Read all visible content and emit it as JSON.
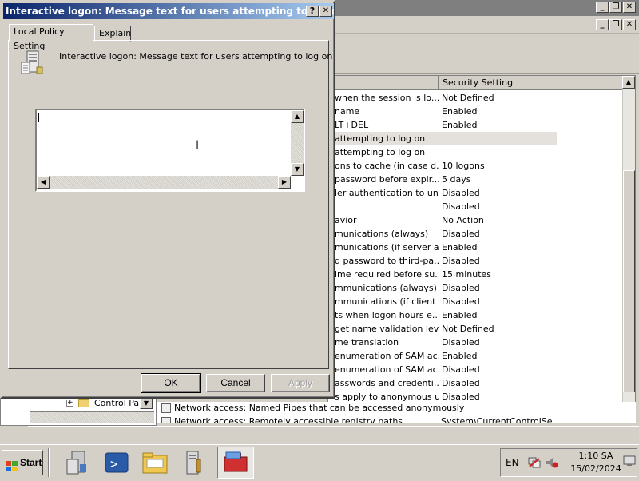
{
  "dialog": {
    "title": "Interactive logon: Message text for users attempting to log on Pr...",
    "tabs": [
      "Local Policy Setting",
      "Explain"
    ],
    "policy_name": "Interactive logon: Message text for users attempting to log on",
    "message_text": "",
    "buttons": {
      "ok": "OK",
      "cancel": "Cancel",
      "apply": "Apply"
    },
    "title_controls": {
      "help": "?",
      "close": "✕"
    }
  },
  "mmc": {
    "header": {
      "policy": "",
      "security_setting": "Security Setting"
    },
    "rows": [
      {
        "policy": "when the session is lo...",
        "setting": "Not Defined"
      },
      {
        "policy": "name",
        "setting": "Enabled"
      },
      {
        "policy": "LT+DEL",
        "setting": "Enabled"
      },
      {
        "policy": "attempting to log on",
        "setting": ""
      },
      {
        "policy": "attempting to log on",
        "setting": ""
      },
      {
        "policy": "ons to cache (in case d...",
        "setting": "10 logons"
      },
      {
        "policy": "password before expir...",
        "setting": "5 days"
      },
      {
        "policy": "ler authentication to un...",
        "setting": "Disabled"
      },
      {
        "policy": "",
        "setting": "Disabled"
      },
      {
        "policy": "avior",
        "setting": "No Action"
      },
      {
        "policy": "munications (always)",
        "setting": "Disabled"
      },
      {
        "policy": "munications (if server a...",
        "setting": "Enabled"
      },
      {
        "policy": "d password to third-pa...",
        "setting": "Disabled"
      },
      {
        "policy": "ime required before su...",
        "setting": "15 minutes"
      },
      {
        "policy": "mmunications (always)",
        "setting": "Disabled"
      },
      {
        "policy": "mmunications (if client a...",
        "setting": "Disabled"
      },
      {
        "policy": "ts when logon hours e...",
        "setting": "Enabled"
      },
      {
        "policy": "get name validation level",
        "setting": "Not Defined"
      },
      {
        "policy": "me translation",
        "setting": "Disabled"
      },
      {
        "policy": "enumeration of SAM ac...",
        "setting": "Enabled"
      },
      {
        "policy": "enumeration of SAM ac...",
        "setting": "Disabled"
      },
      {
        "policy": "asswords and credenti...",
        "setting": "Disabled"
      },
      {
        "policy": "s apply to anonymous u...",
        "setting": "Disabled"
      }
    ],
    "bottom_rows": [
      {
        "policy": "Network access: Named Pipes that can be accessed anonymously",
        "setting": ""
      },
      {
        "policy": "Network access: Remotely accessible registry paths",
        "setting": "System\\CurrentControlSe"
      }
    ],
    "tree_item": "Control Pan"
  },
  "taskbar": {
    "start_label": "Start",
    "language": "EN",
    "time": "1:10 SA",
    "date": "15/02/2024"
  }
}
